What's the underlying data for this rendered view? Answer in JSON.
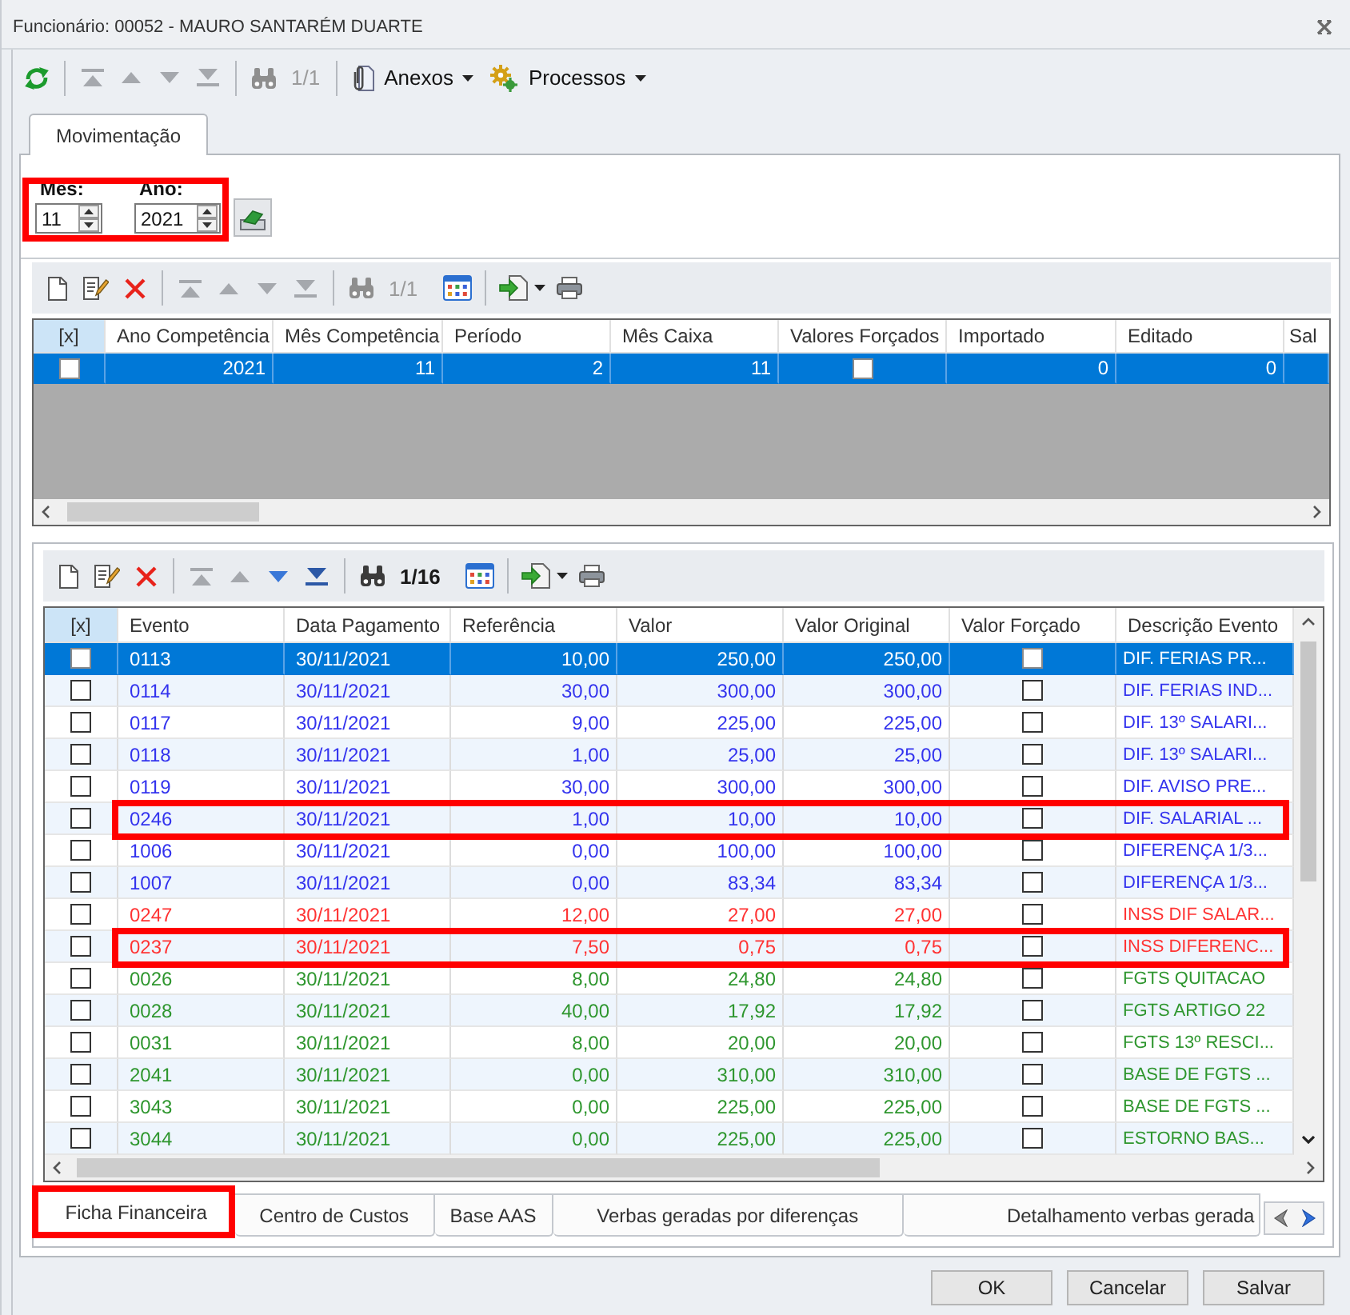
{
  "window": {
    "title": "Funcionário: 00052 - MAURO SANTARÉM DUARTE"
  },
  "toolbar": {
    "groups": [
      [
        {
          "kind": "refresh",
          "disabled": false
        }
      ],
      [
        {
          "kind": "first",
          "disabled": true
        },
        {
          "kind": "previous",
          "disabled": true
        },
        {
          "kind": "next",
          "disabled": true
        },
        {
          "kind": "last",
          "disabled": true
        }
      ],
      [
        {
          "kind": "find",
          "disabled": true
        },
        {
          "kind": "counter",
          "label": "1/1",
          "disabled": true
        }
      ],
      [
        {
          "kind": "attachments",
          "label": "Anexos",
          "disabled": false
        },
        {
          "kind": "processes",
          "label": "Processos",
          "disabled": false
        }
      ]
    ]
  },
  "tabs": [
    {
      "label": "Movimentação",
      "selected": true
    }
  ],
  "period_filter": {
    "highlighted": true,
    "month": {
      "label": "Mês:",
      "value": "11"
    },
    "year": {
      "label": "Ano:",
      "value": "2021"
    }
  },
  "periods": {
    "toolbar": {
      "groups": [
        [
          {
            "kind": "new",
            "disabled": false
          },
          {
            "kind": "edit",
            "disabled": false
          },
          {
            "kind": "delete",
            "disabled": false
          }
        ],
        [
          {
            "kind": "first",
            "disabled": true
          },
          {
            "kind": "previous",
            "disabled": true
          },
          {
            "kind": "next",
            "disabled": true
          },
          {
            "kind": "last",
            "disabled": true
          }
        ],
        [
          {
            "kind": "find",
            "disabled": true
          },
          {
            "kind": "counter",
            "label": "1/1",
            "disabled": true
          },
          {
            "kind": "columns",
            "disabled": false
          }
        ],
        [
          {
            "kind": "export",
            "disabled": false
          },
          {
            "kind": "print",
            "disabled": false
          }
        ]
      ]
    },
    "columns": [
      "[x]",
      "Ano Competência",
      "Mês Competência",
      "Período",
      "Mês Caixa",
      "Valores Forçados",
      "Importado",
      "Editado",
      "Sal"
    ],
    "rows": [
      {
        "selected": true,
        "checked": false,
        "ano_competencia": "2021",
        "mes_competencia": "11",
        "periodo": "2",
        "mes_caixa": "11",
        "valores_forcados": false,
        "importado": "0",
        "editado": "0"
      }
    ]
  },
  "events": {
    "toolbar": {
      "groups": [
        [
          {
            "kind": "new",
            "disabled": false
          },
          {
            "kind": "edit",
            "disabled": false
          },
          {
            "kind": "delete",
            "disabled": false
          }
        ],
        [
          {
            "kind": "first",
            "disabled": true
          },
          {
            "kind": "previous",
            "disabled": true
          },
          {
            "kind": "next",
            "disabled": false
          },
          {
            "kind": "last",
            "disabled": false
          }
        ],
        [
          {
            "kind": "find",
            "disabled": false
          },
          {
            "kind": "counter",
            "label": "1/16",
            "disabled": false
          },
          {
            "kind": "columns",
            "disabled": false
          }
        ],
        [
          {
            "kind": "export",
            "disabled": false
          },
          {
            "kind": "print",
            "disabled": false
          }
        ]
      ]
    },
    "columns": [
      "[x]",
      "Evento",
      "Data Pagamento",
      "Referência",
      "Valor",
      "Valor Original",
      "Valor Forçado",
      "Descrição Evento"
    ],
    "rows": [
      {
        "selected": true,
        "highlighted": false,
        "checked": false,
        "evento": "0113",
        "data_pagamento": "30/11/2021",
        "referencia": "10,00",
        "valor": "250,00",
        "valor_original": "250,00",
        "valor_forcado": false,
        "descricao": "DIF. FERIAS PR..."
      },
      {
        "selected": false,
        "highlighted": false,
        "color": "#3333ee",
        "checked": false,
        "evento": "0114",
        "data_pagamento": "30/11/2021",
        "referencia": "30,00",
        "valor": "300,00",
        "valor_original": "300,00",
        "valor_forcado": false,
        "descricao": "DIF. FERIAS IND..."
      },
      {
        "selected": false,
        "highlighted": false,
        "color": "#3333ee",
        "checked": false,
        "evento": "0117",
        "data_pagamento": "30/11/2021",
        "referencia": "9,00",
        "valor": "225,00",
        "valor_original": "225,00",
        "valor_forcado": false,
        "descricao": "DIF. 13º SALARI..."
      },
      {
        "selected": false,
        "highlighted": false,
        "color": "#3333ee",
        "checked": false,
        "evento": "0118",
        "data_pagamento": "30/11/2021",
        "referencia": "1,00",
        "valor": "25,00",
        "valor_original": "25,00",
        "valor_forcado": false,
        "descricao": "DIF. 13º SALARI..."
      },
      {
        "selected": false,
        "highlighted": false,
        "color": "#3333ee",
        "checked": false,
        "evento": "0119",
        "data_pagamento": "30/11/2021",
        "referencia": "30,00",
        "valor": "300,00",
        "valor_original": "300,00",
        "valor_forcado": false,
        "descricao": "DIF. AVISO PRE..."
      },
      {
        "selected": false,
        "highlighted": true,
        "color": "#3333ee",
        "checked": false,
        "evento": "0246",
        "data_pagamento": "30/11/2021",
        "referencia": "1,00",
        "valor": "10,00",
        "valor_original": "10,00",
        "valor_forcado": false,
        "descricao": "DIF. SALARIAL ..."
      },
      {
        "selected": false,
        "highlighted": false,
        "color": "#3333ee",
        "checked": false,
        "evento": "1006",
        "data_pagamento": "30/11/2021",
        "referencia": "0,00",
        "valor": "100,00",
        "valor_original": "100,00",
        "valor_forcado": false,
        "descricao": "DIFERENÇA 1/3..."
      },
      {
        "selected": false,
        "highlighted": false,
        "color": "#3333ee",
        "checked": false,
        "evento": "1007",
        "data_pagamento": "30/11/2021",
        "referencia": "0,00",
        "valor": "83,34",
        "valor_original": "83,34",
        "valor_forcado": false,
        "descricao": "DIFERENÇA 1/3..."
      },
      {
        "selected": false,
        "highlighted": false,
        "color": "#ff3333",
        "checked": false,
        "evento": "0247",
        "data_pagamento": "30/11/2021",
        "referencia": "12,00",
        "valor": "27,00",
        "valor_original": "27,00",
        "valor_forcado": false,
        "descricao": "INSS DIF SALAR..."
      },
      {
        "selected": false,
        "highlighted": true,
        "color": "#ff3333",
        "checked": false,
        "evento": "0237",
        "data_pagamento": "30/11/2021",
        "referencia": "7,50",
        "valor": "0,75",
        "valor_original": "0,75",
        "valor_forcado": false,
        "descricao": "INSS DIFERENC..."
      },
      {
        "selected": false,
        "highlighted": false,
        "color": "#2e962e",
        "checked": false,
        "evento": "0026",
        "data_pagamento": "30/11/2021",
        "referencia": "8,00",
        "valor": "24,80",
        "valor_original": "24,80",
        "valor_forcado": false,
        "descricao": "FGTS QUITACAO"
      },
      {
        "selected": false,
        "highlighted": false,
        "color": "#2e962e",
        "checked": false,
        "evento": "0028",
        "data_pagamento": "30/11/2021",
        "referencia": "40,00",
        "valor": "17,92",
        "valor_original": "17,92",
        "valor_forcado": false,
        "descricao": "FGTS ARTIGO 22"
      },
      {
        "selected": false,
        "highlighted": false,
        "color": "#2e962e",
        "checked": false,
        "evento": "0031",
        "data_pagamento": "30/11/2021",
        "referencia": "8,00",
        "valor": "20,00",
        "valor_original": "20,00",
        "valor_forcado": false,
        "descricao": "FGTS 13º RESCI..."
      },
      {
        "selected": false,
        "highlighted": false,
        "color": "#2e962e",
        "checked": false,
        "evento": "2041",
        "data_pagamento": "30/11/2021",
        "referencia": "0,00",
        "valor": "310,00",
        "valor_original": "310,00",
        "valor_forcado": false,
        "descricao": "BASE DE FGTS ..."
      },
      {
        "selected": false,
        "highlighted": false,
        "color": "#2e962e",
        "checked": false,
        "evento": "3043",
        "data_pagamento": "30/11/2021",
        "referencia": "0,00",
        "valor": "225,00",
        "valor_original": "225,00",
        "valor_forcado": false,
        "descricao": "BASE DE FGTS ..."
      },
      {
        "selected": false,
        "highlighted": false,
        "color": "#2e962e",
        "checked": false,
        "evento": "3044",
        "data_pagamento": "30/11/2021",
        "referencia": "0,00",
        "valor": "225,00",
        "valor_original": "225,00",
        "valor_forcado": false,
        "descricao": "ESTORNO BAS..."
      }
    ]
  },
  "bottom_tabs": [
    {
      "label": "Ficha Financeira",
      "selected": true,
      "highlighted": true
    },
    {
      "label": "Centro de Custos",
      "selected": false,
      "highlighted": false
    },
    {
      "label": "Base AAS",
      "selected": false,
      "highlighted": false
    },
    {
      "label": "Verbas geradas por diferenças",
      "selected": false,
      "highlighted": false
    },
    {
      "label": "Detalhamento verbas gerada",
      "selected": false,
      "highlighted": false
    }
  ],
  "buttons": [
    "OK",
    "Cancelar",
    "Salvar"
  ]
}
